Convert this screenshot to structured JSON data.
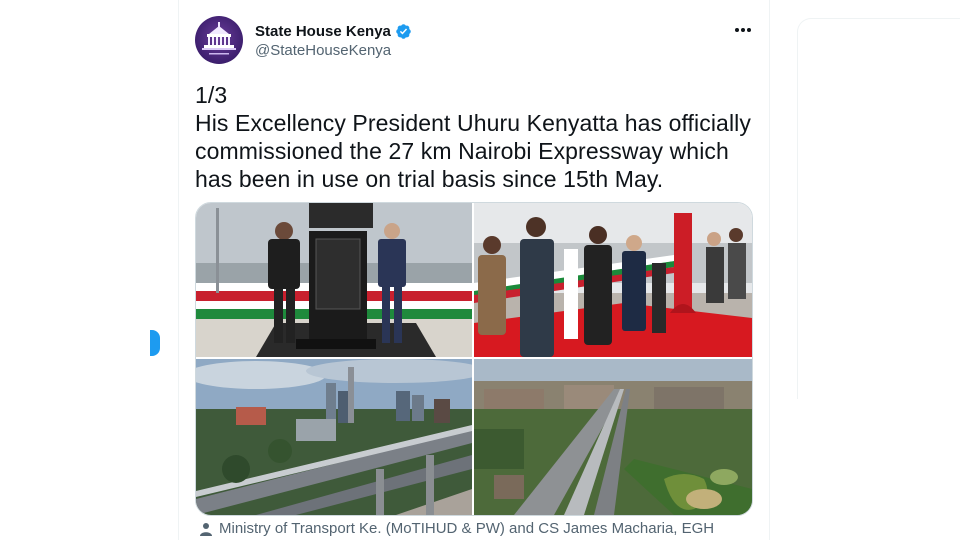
{
  "author": {
    "display_name": "State House Kenya",
    "handle": "@StateHouseKenya",
    "verified": true,
    "avatar_icon": "state-house-logo-icon"
  },
  "tweet": {
    "text": "1/3\nHis Excellency President Uhuru Kenyatta has officially commissioned the 27 km Nairobi Expressway which has been in use on trial basis since 15th May."
  },
  "media": [
    {
      "name": "photo-plaque-unveiling",
      "description_icon": "photo"
    },
    {
      "name": "photo-ribbon-cutting",
      "description_icon": "photo"
    },
    {
      "name": "photo-expressway-city",
      "description_icon": "photo"
    },
    {
      "name": "photo-expressway-aerial",
      "description_icon": "photo"
    }
  ],
  "tagged": {
    "icon": "person-icon",
    "text": "Ministry of Transport Ke. (MoTIHUD & PW) and CS James Macharia, EGH"
  },
  "colors": {
    "accent": "#1d9bf0",
    "text_primary": "#0f1419",
    "text_secondary": "#536471",
    "border": "#cfd9de"
  }
}
